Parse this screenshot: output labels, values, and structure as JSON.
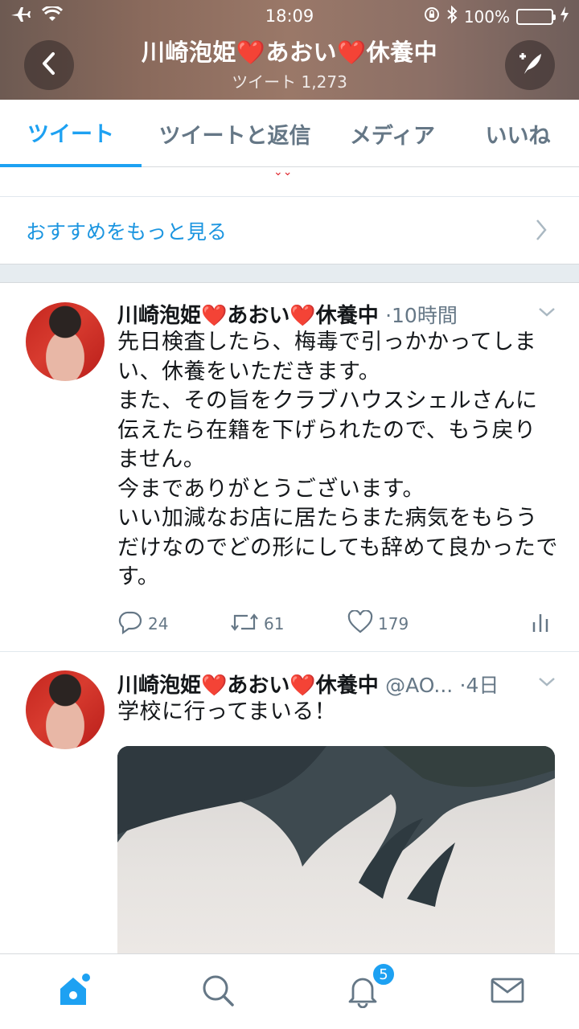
{
  "status_bar": {
    "time": "18:09",
    "battery": "100%"
  },
  "header": {
    "name_part1": "川崎泡姫",
    "name_part2": "あおい",
    "name_part3": "休養中",
    "heart": "❤️",
    "subtitle": "ツイート 1,273"
  },
  "tabs": [
    {
      "label": "ツイート",
      "active": true
    },
    {
      "label": "ツイートと返信",
      "active": false
    },
    {
      "label": "メディア",
      "active": false
    },
    {
      "label": "いいね",
      "active": false
    }
  ],
  "recommendation": {
    "label": "おすすめをもっと見る"
  },
  "tweets": [
    {
      "name_part1": "川崎泡姫",
      "name_part2": "あおい",
      "name_part3": "休養中",
      "meta": "·10時間",
      "body": "先日検査したら、梅毒で引っかかってしまい、休養をいただきます。\nまた、その旨をクラブハウスシェルさんに伝えたら在籍を下げられたので、もう戻りません。\n今までありがとうございます。\nいい加減なお店に居たらまた病気をもらうだけなのでどの形にしても辞めて良かったです。",
      "replies": "24",
      "retweets": "61",
      "likes": "179"
    },
    {
      "name_part1": "川崎泡姫",
      "name_part2": "あおい",
      "name_part3": "休養中",
      "handle": "@AO...",
      "meta": "·4日",
      "body": "学校に行ってまいる！"
    }
  ],
  "bottom_nav": {
    "notifications_badge": "5"
  },
  "colors": {
    "accent": "#1da1f2",
    "heart": "#e0262d",
    "secondary_text": "#657786"
  }
}
